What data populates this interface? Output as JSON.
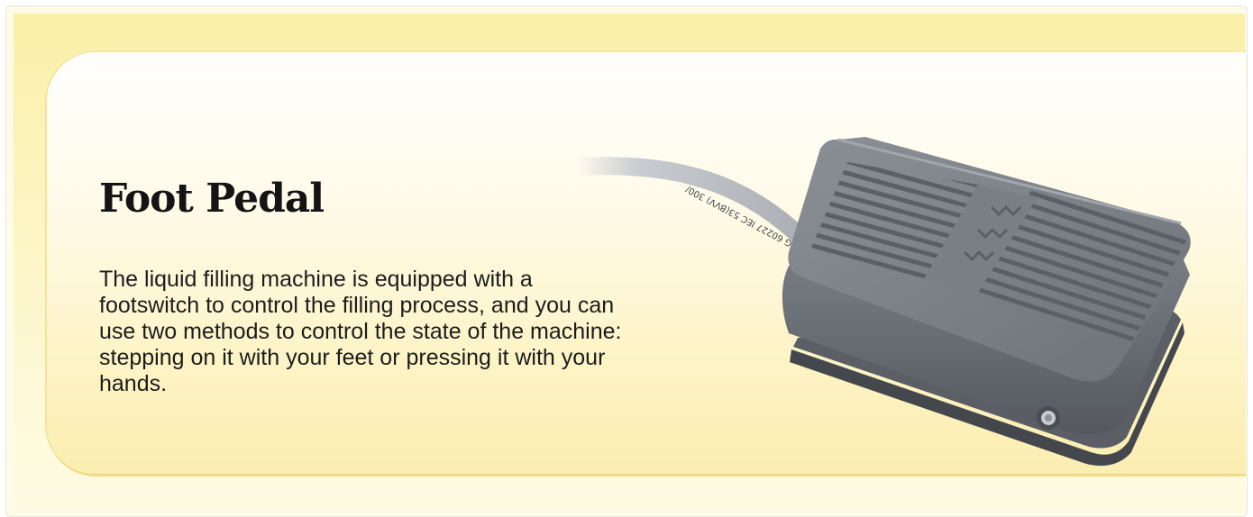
{
  "section": {
    "title": "Foot Pedal",
    "description": "The liquid filling machine is equipped with a footswitch to control the filling process, and you can use two methods to control the state of the machine: stepping on it with your feet or pressing it with your hands."
  },
  "image": {
    "subject": "foot-pedal-switch",
    "cable_print": "ANG 60227 IEC 53(BVV) 300/"
  },
  "colors": {
    "banner": "#faf0a8",
    "card": "#fffbea",
    "text": "#141414",
    "pedal_body": "#6c7077"
  }
}
